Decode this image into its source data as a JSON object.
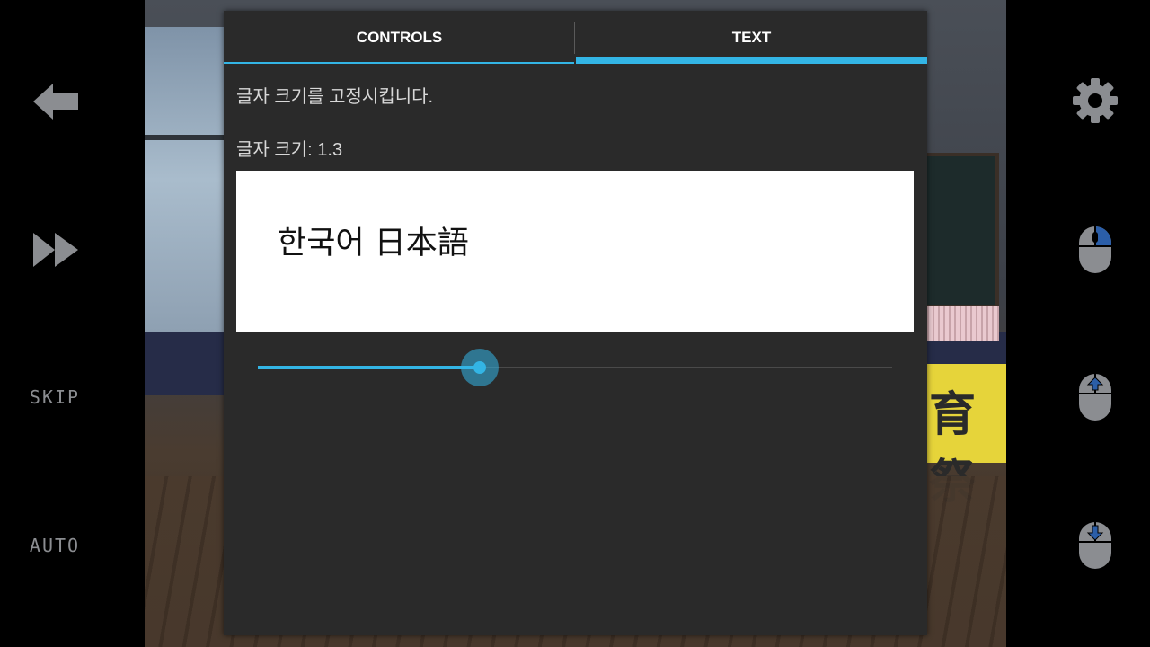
{
  "left_controls": {
    "back_icon": "arrow-left-icon",
    "fast_forward_icon": "fast-forward-icon",
    "skip_label": "SKIP",
    "auto_label": "AUTO"
  },
  "right_controls": {
    "settings_icon": "gear-icon",
    "mouse_icons": [
      "mouse-click-icon",
      "mouse-scroll-up-icon",
      "mouse-scroll-down-icon"
    ]
  },
  "dialog": {
    "tabs": [
      {
        "label": "CONTROLS",
        "selected": false
      },
      {
        "label": "TEXT",
        "selected": true
      }
    ],
    "description": "글자 크기를 고정시킵니다.",
    "font_size_label": "글자 크기: 1.3",
    "preview_text": "한국어 日本語",
    "slider_fraction": 0.35
  },
  "background": {
    "banner_text": "育 祭"
  },
  "colors": {
    "accent": "#33b5e5",
    "dialog_bg": "#2a2a2a",
    "side_button": "#8b8d91"
  }
}
